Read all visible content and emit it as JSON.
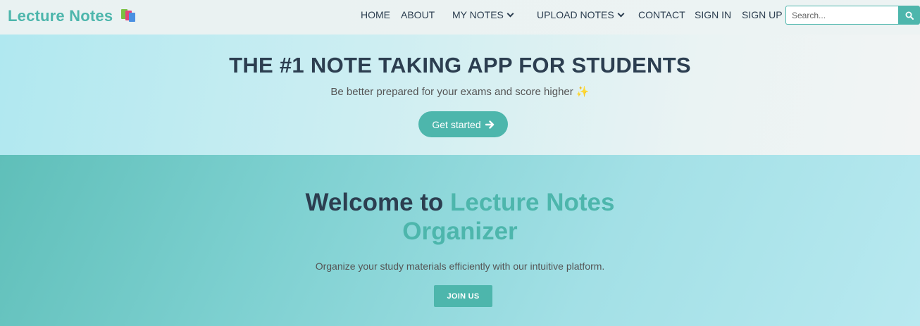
{
  "nav": {
    "brand": "Lecture Notes",
    "brand_icon": "books-icon",
    "links": {
      "home": "HOME",
      "about": "ABOUT",
      "my_notes": "MY NOTES",
      "upload_notes": "UPLOAD NOTES",
      "contact": "CONTACT",
      "sign_in": "SIGN IN",
      "sign_up": "SIGN UP"
    },
    "search": {
      "placeholder": "Search...",
      "value": "",
      "icon": "search-icon"
    }
  },
  "hero": {
    "title": "THE #1 NOTE TAKING APP FOR STUDENTS",
    "subtitle": "Be better prepared for your exams and score higher",
    "subtitle_emoji": "✨",
    "cta": "Get started",
    "cta_icon": "arrow-right-icon"
  },
  "welcome": {
    "title_prefix": "Welcome to",
    "title_accent_line1": "Lecture Notes",
    "title_accent_line2": "Organizer",
    "subtitle": "Organize your study materials efficiently with our intuitive platform.",
    "button": "JOIN US"
  },
  "colors": {
    "accent": "#4db6ac",
    "text_dark": "#2c3e50"
  }
}
